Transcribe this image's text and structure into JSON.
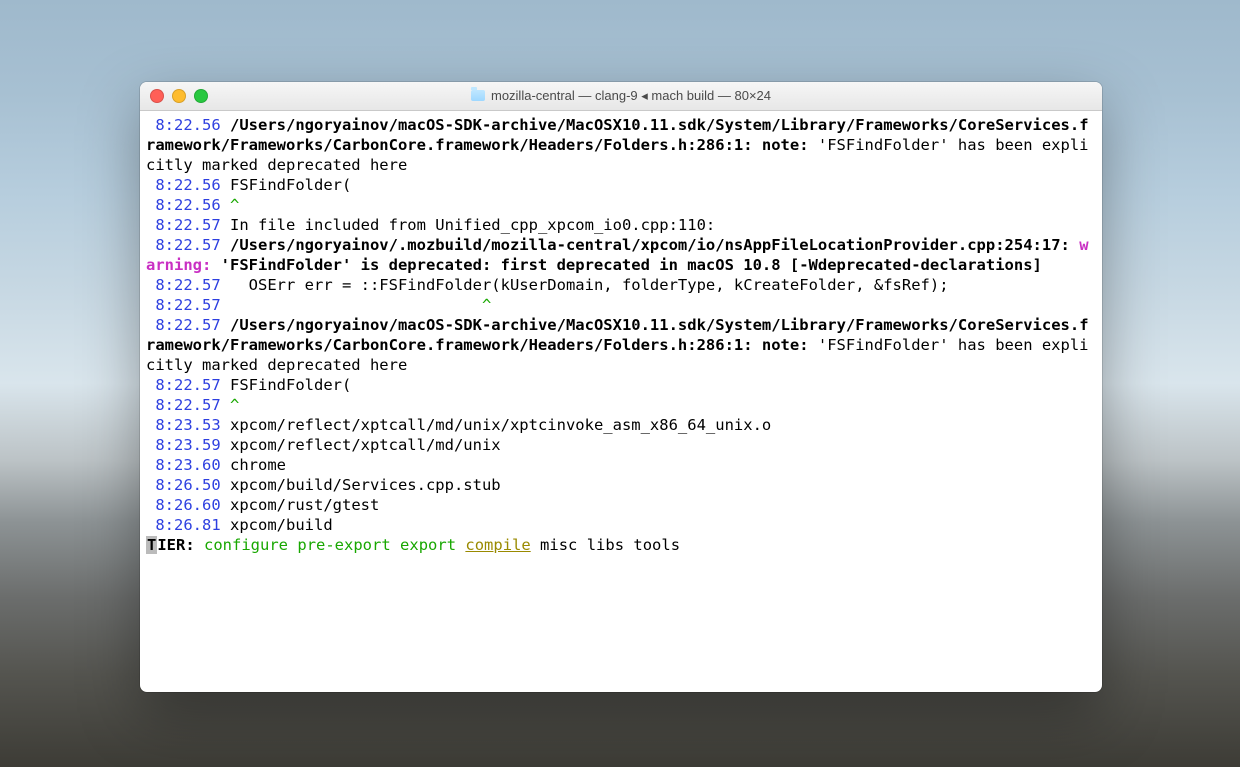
{
  "window": {
    "title": "mozilla-central — clang-9 ◂ mach build — 80×24"
  },
  "lines": [
    {
      "ts": " 8:22.56",
      "bold": true,
      "text": " /Users/ngoryainov/macOS-SDK-archive/MacOSX10.11.sdk/System/Library/Frameworks/CoreServices.framework/Frameworks/CarbonCore.framework/Headers/Folders.h:286:1: note: ",
      "tail": "'FSFindFolder' has been explicitly marked deprecated here"
    },
    {
      "ts": " 8:22.56",
      "text": " FSFindFolder("
    },
    {
      "ts": " 8:22.56",
      "caret_green": " ^"
    },
    {
      "ts": " 8:22.57",
      "text": " In file included from Unified_cpp_xpcom_io0.cpp:110:"
    },
    {
      "ts": " 8:22.57",
      "bold": true,
      "text": " /Users/ngoryainov/.mozbuild/mozilla-central/xpcom/io/nsAppFileLocationProvider.cpp:254:17: ",
      "warn": "warning: ",
      "tailbold": "'FSFindFolder' is deprecated: first deprecated in macOS 10.8 [-Wdeprecated-declarations]"
    },
    {
      "ts": " 8:22.57",
      "text": "   OSErr err = ::FSFindFolder(kUserDomain, folderType, kCreateFolder, &fsRef);"
    },
    {
      "ts": " 8:22.57",
      "caret_green": "                            ^"
    },
    {
      "ts": " 8:22.57",
      "bold": true,
      "text": " /Users/ngoryainov/macOS-SDK-archive/MacOSX10.11.sdk/System/Library/Frameworks/CoreServices.framework/Frameworks/CarbonCore.framework/Headers/Folders.h:286:1: note: ",
      "tail": "'FSFindFolder' has been explicitly marked deprecated here"
    },
    {
      "ts": " 8:22.57",
      "text": " FSFindFolder("
    },
    {
      "ts": " 8:22.57",
      "caret_green": " ^"
    },
    {
      "ts": " 8:23.53",
      "text": " xpcom/reflect/xptcall/md/unix/xptcinvoke_asm_x86_64_unix.o"
    },
    {
      "ts": " 8:23.59",
      "text": " xpcom/reflect/xptcall/md/unix"
    },
    {
      "ts": " 8:23.60",
      "text": " chrome"
    },
    {
      "ts": " 8:26.50",
      "text": " xpcom/build/Services.cpp.stub"
    },
    {
      "ts": " 8:26.60",
      "text": " xpcom/rust/gtest"
    },
    {
      "ts": " 8:26.81",
      "text": " xpcom/build"
    }
  ],
  "tier": {
    "label": "TIER:",
    "stages": [
      "configure",
      "pre-export",
      "export",
      "compile",
      "misc",
      "libs",
      "tools"
    ],
    "current": "compile"
  }
}
